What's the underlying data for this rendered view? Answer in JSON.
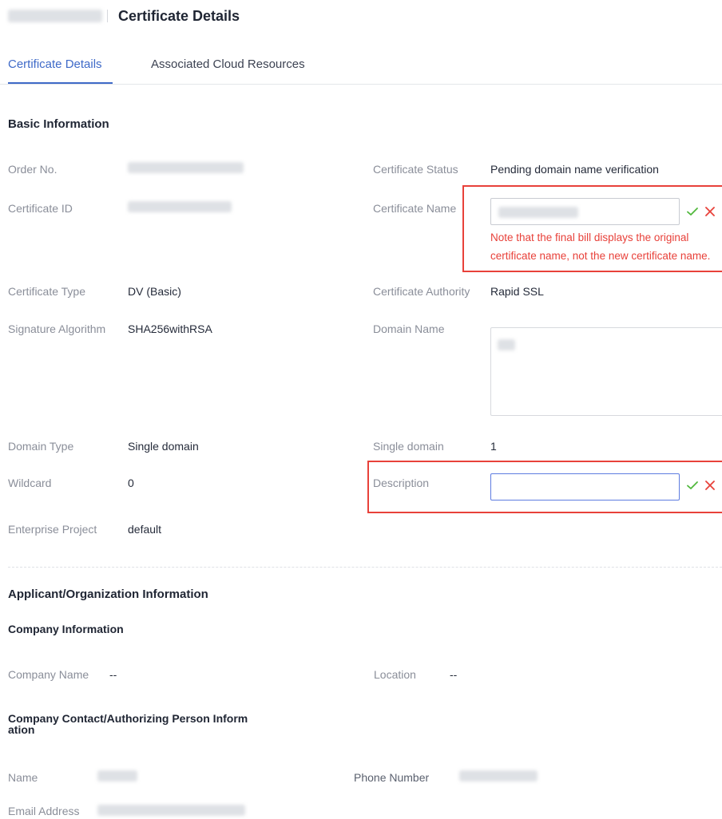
{
  "header": {
    "title": "Certificate Details"
  },
  "tabs": [
    {
      "label": "Certificate Details",
      "active": true
    },
    {
      "label": "Associated Cloud Resources",
      "active": false
    }
  ],
  "basic_info": {
    "heading": "Basic Information",
    "order_no_label": "Order No.",
    "certificate_status_label": "Certificate Status",
    "certificate_status_value": "Pending domain name verification",
    "certificate_id_label": "Certificate ID",
    "certificate_name_label": "Certificate Name",
    "certificate_name_note": "Note that the final bill displays the original certificate name, not the new certificate name.",
    "certificate_type_label": "Certificate Type",
    "certificate_type_value": "DV (Basic)",
    "certificate_authority_label": "Certificate Authority",
    "certificate_authority_value": "Rapid SSL",
    "signature_algorithm_label": "Signature Algorithm",
    "signature_algorithm_value": "SHA256withRSA",
    "domain_name_label": "Domain Name",
    "domain_type_label": "Domain Type",
    "domain_type_value": "Single domain",
    "single_domain_label": "Single domain",
    "single_domain_value": "1",
    "wildcard_label": "Wildcard",
    "wildcard_value": "0",
    "description_label": "Description",
    "description_value": "",
    "enterprise_project_label": "Enterprise Project",
    "enterprise_project_value": "default"
  },
  "applicant": {
    "heading": "Applicant/Organization Information",
    "company_info_heading": "Company Information",
    "company_name_label": "Company Name",
    "company_name_value": "--",
    "location_label": "Location",
    "location_value": "--",
    "contact_heading_line1": "Company Contact/Authorizing Person Inform",
    "contact_heading_line2": "ation",
    "name_label": "Name",
    "phone_number_label": "Phone Number",
    "email_address_label": "Email Address"
  },
  "colors": {
    "accent": "#3f6ac8",
    "focus_border": "#5e7ce0",
    "highlight_red": "#e8413a",
    "confirm_green": "#50b83c",
    "cancel_red": "#e8413a",
    "label_gray": "#8a8e99"
  }
}
